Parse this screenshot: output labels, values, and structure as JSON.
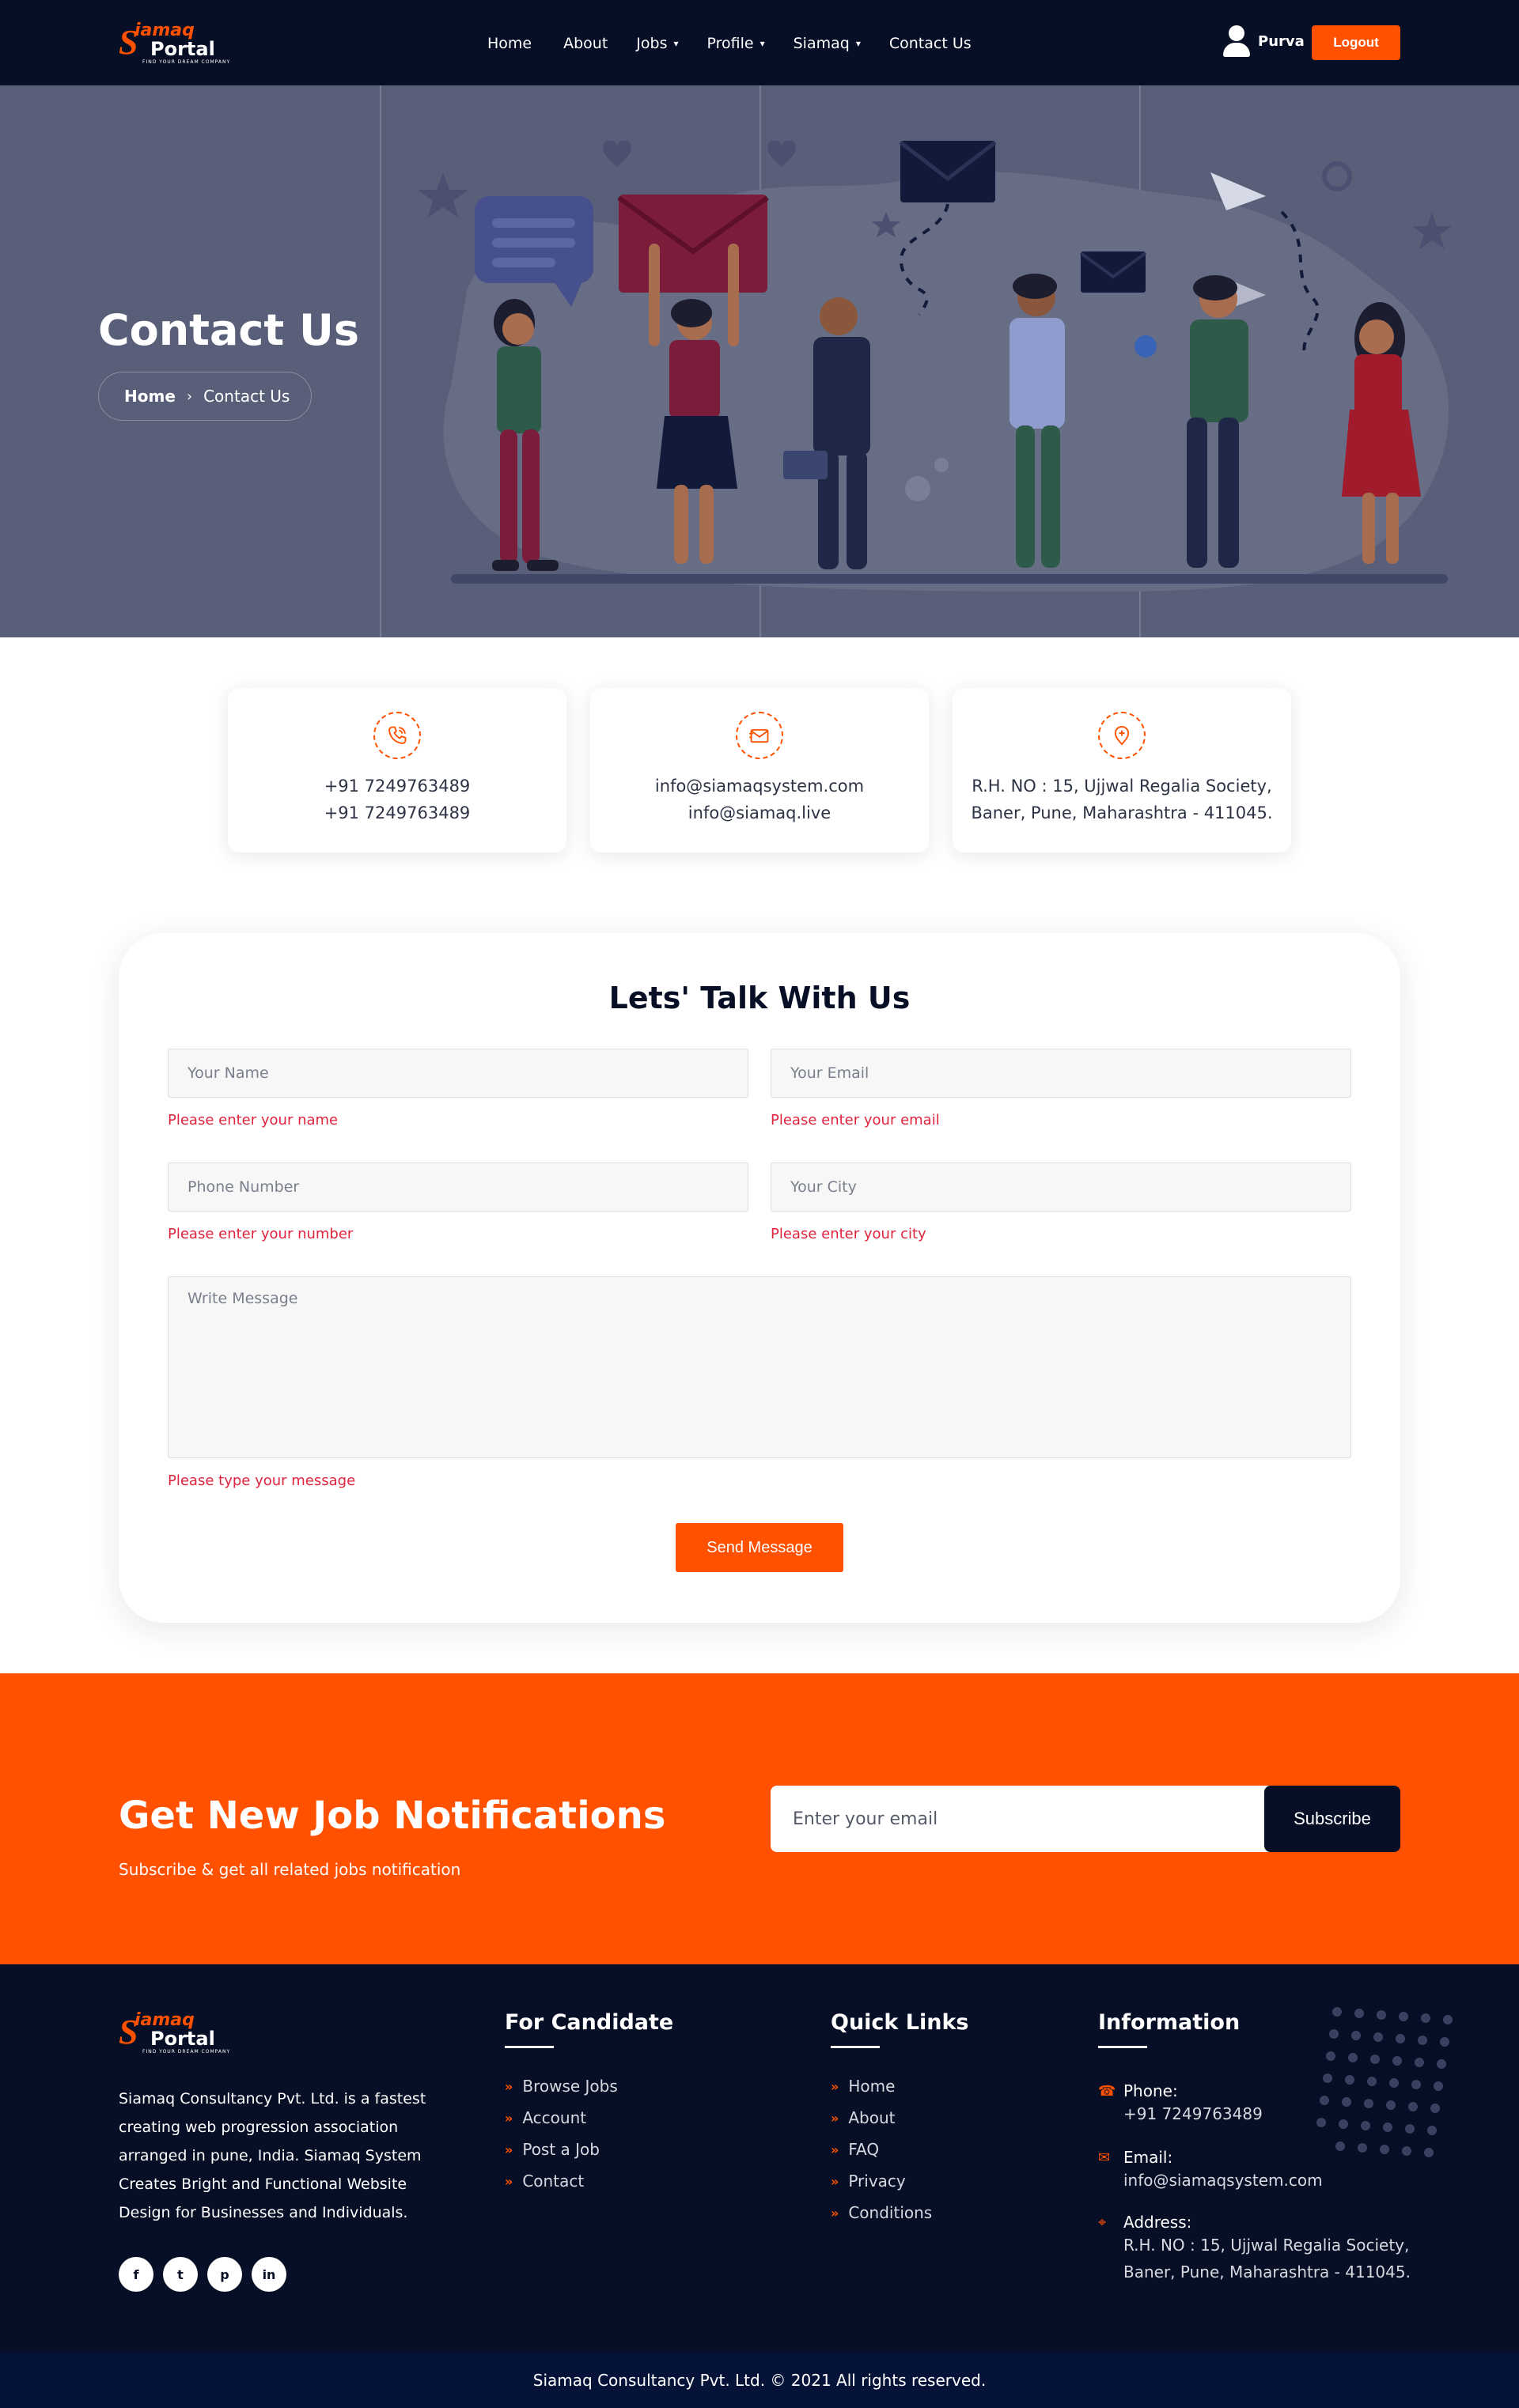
{
  "nav": {
    "logo": {
      "s": "S",
      "top": "iamaq",
      "bottom": "Portal",
      "tagline": "FIND YOUR DREAM COMPANY"
    },
    "items": [
      {
        "label": "Home",
        "has_dropdown": false
      },
      {
        "label": "About",
        "has_dropdown": false
      },
      {
        "label": "Jobs",
        "has_dropdown": true
      },
      {
        "label": "Profile",
        "has_dropdown": true
      },
      {
        "label": "Siamaq",
        "has_dropdown": true
      },
      {
        "label": "Contact Us",
        "has_dropdown": false
      }
    ],
    "user_name": "Purva",
    "logout_label": "Logout"
  },
  "hero": {
    "title": "Contact Us",
    "breadcrumb": {
      "home": "Home",
      "separator": "›",
      "current": "Contact Us"
    }
  },
  "contact_cards": [
    {
      "icon": "phone-icon",
      "line1": "+91 7249763489",
      "line2": "+91 7249763489"
    },
    {
      "icon": "envelope-icon",
      "line1": "info@siamaqsystem.com",
      "line2": "info@siamaq.live"
    },
    {
      "icon": "location-pin-icon",
      "line1": "R.H. NO : 15, Ujjwal Regalia Society,",
      "line2": "Baner, Pune, Maharashtra - 411045."
    }
  ],
  "form": {
    "title": "Lets' Talk With Us",
    "name": {
      "placeholder": "Your Name",
      "error": "Please enter your name"
    },
    "email": {
      "placeholder": "Your Email",
      "error": "Please enter your email"
    },
    "phone": {
      "placeholder": "Phone Number",
      "error": "Please enter your number"
    },
    "city": {
      "placeholder": "Your City",
      "error": "Please enter your city"
    },
    "message": {
      "placeholder": "Write Message",
      "error": "Please type your message"
    },
    "submit_label": "Send Message"
  },
  "newsletter": {
    "title": "Get New Job Notifications",
    "subtitle": "Subscribe & get all related jobs notification",
    "placeholder": "Enter your email",
    "button_label": "Subscribe"
  },
  "footer": {
    "about": "Siamaq Consultancy Pvt. Ltd. is a fastest creating web progression association arranged in pune, India. Siamaq System Creates Bright and Functional Website Design for Businesses and Individuals.",
    "socials": [
      {
        "icon": "facebook-icon",
        "glyph": "f"
      },
      {
        "icon": "twitter-icon",
        "glyph": "t"
      },
      {
        "icon": "pinterest-icon",
        "glyph": "p"
      },
      {
        "icon": "linkedin-icon",
        "glyph": "in"
      }
    ],
    "candidate": {
      "title": "For Candidate",
      "links": [
        "Browse Jobs",
        "Account",
        "Post a Job",
        "Contact"
      ]
    },
    "quick": {
      "title": "Quick Links",
      "links": [
        "Home",
        "About",
        "FAQ",
        "Privacy",
        "Conditions"
      ]
    },
    "info": {
      "title": "Information",
      "phone_label": "Phone:",
      "phone": "+91 7249763489",
      "email_label": "Email:",
      "email": "info@siamaqsystem.com",
      "address_label": "Address:",
      "address1": "R.H. NO : 15, Ujjwal Regalia Society,",
      "address2": "Baner, Pune, Maharashtra - 411045."
    },
    "copyright": "Siamaq Consultancy Pvt. Ltd. © 2021 All rights reserved."
  },
  "colors": {
    "accent": "#ff5100",
    "navy": "#070f26",
    "error": "#e0233e",
    "hero_bg": "#5a5f79"
  }
}
